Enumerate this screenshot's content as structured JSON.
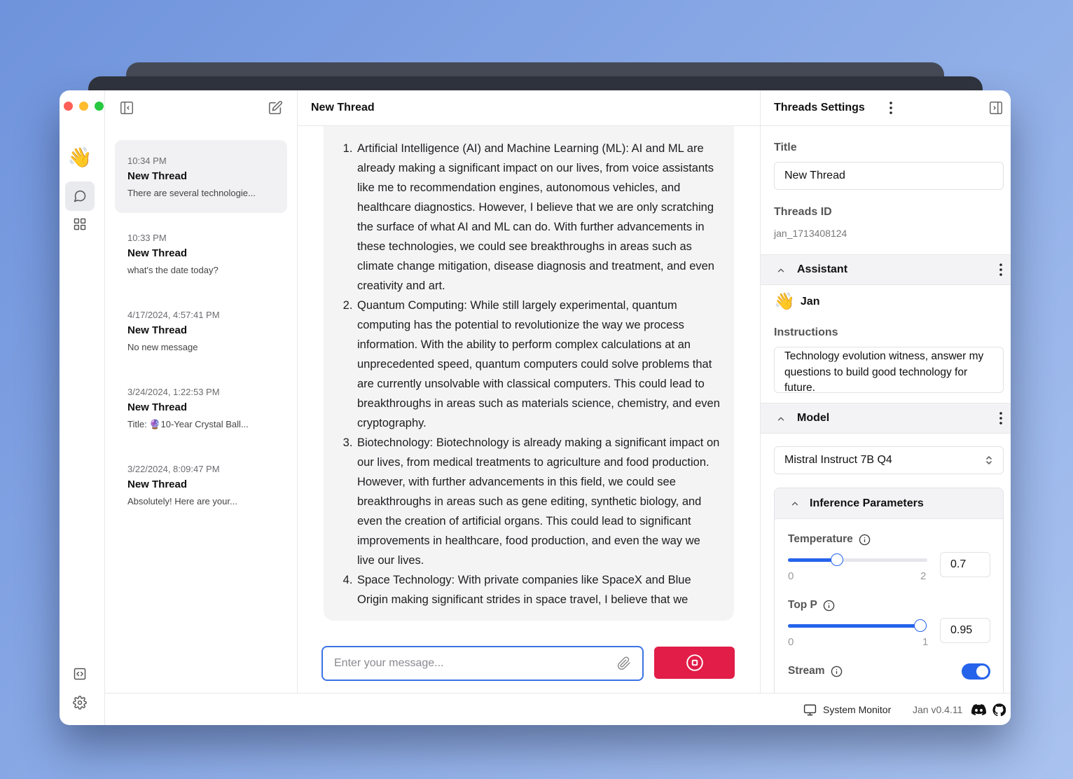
{
  "window": {
    "traffic_lights": {
      "close": "#fe5f57",
      "minimize": "#febc2e",
      "maximize": "#28c840"
    }
  },
  "rail": {
    "logo_emoji": "👋",
    "items": [
      "chat-icon",
      "grid-icon",
      "code-icon",
      "gear-icon"
    ]
  },
  "threads": [
    {
      "time": "10:34 PM",
      "title": "New Thread",
      "preview": "There are several technologie..."
    },
    {
      "time": "10:33 PM",
      "title": "New Thread",
      "preview": "what's the date today?"
    },
    {
      "time": "4/17/2024, 4:57:41 PM",
      "title": "New Thread",
      "preview": "No new message"
    },
    {
      "time": "3/24/2024, 1:22:53 PM",
      "title": "New Thread",
      "preview": "Title: 🔮10-Year Crystal Ball..."
    },
    {
      "time": "3/22/2024, 8:09:47 PM",
      "title": "New Thread",
      "preview": "Absolutely! Here are your..."
    }
  ],
  "main": {
    "title": "New Thread",
    "message_items": [
      "Artificial Intelligence (AI) and Machine Learning (ML): AI and ML are already making a significant impact on our lives, from voice assistants like me to recommendation engines, autonomous vehicles, and healthcare diagnostics. However, I believe that we are only scratching the surface of what AI and ML can do. With further advancements in these technologies, we could see breakthroughs in areas such as climate change mitigation, disease diagnosis and treatment, and even creativity and art.",
      "Quantum Computing: While still largely experimental, quantum computing has the potential to revolutionize the way we process information. With the ability to perform complex calculations at an unprecedented speed, quantum computers could solve problems that are currently unsolvable with classical computers. This could lead to breakthroughs in areas such as materials science, chemistry, and even cryptography.",
      "Biotechnology: Biotechnology is already making a significant impact on our lives, from medical treatments to agriculture and food production. However, with further advancements in this field, we could see breakthroughs in areas such as gene editing, synthetic biology, and even the creation of artificial organs. This could lead to significant improvements in healthcare, food production, and even the way we live our lives.",
      "Space Technology: With private companies like SpaceX and Blue Origin making significant strides in space travel, I believe that we"
    ],
    "composer_placeholder": "Enter your message..."
  },
  "settings": {
    "header": "Threads Settings",
    "title_label": "Title",
    "title_value": "New Thread",
    "id_label": "Threads ID",
    "id_value": "jan_1713408124",
    "assistant_section": "Assistant",
    "assistant_emoji": "👋",
    "assistant_name": "Jan",
    "instructions_label": "Instructions",
    "instructions_value": "Technology evolution witness, answer my questions to build good technology for future.",
    "model_section": "Model",
    "model_value": "Mistral Instruct 7B Q4",
    "inference_section": "Inference Parameters",
    "temperature": {
      "label": "Temperature",
      "min": "0",
      "max": "2",
      "value": "0.7",
      "fraction": 0.35
    },
    "top_p": {
      "label": "Top P",
      "min": "0",
      "max": "1",
      "value": "0.95",
      "fraction": 0.95
    },
    "stream": {
      "label": "Stream",
      "enabled": true
    }
  },
  "footer": {
    "system_monitor": "System Monitor",
    "version": "Jan v0.4.11"
  },
  "colors": {
    "accent": "#2563eb",
    "stop": "#e11d48"
  }
}
